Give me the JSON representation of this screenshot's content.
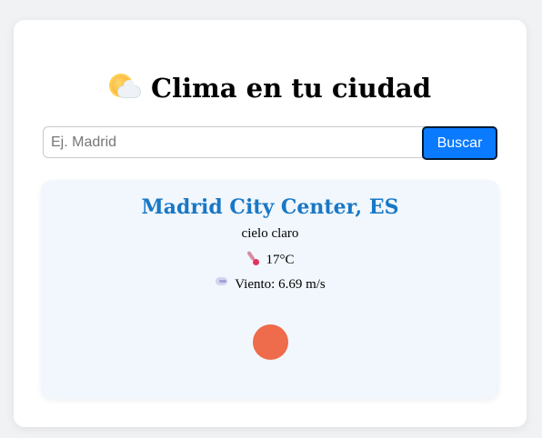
{
  "header": {
    "title": "Clima en tu ciudad",
    "title_icon": "sun-behind-cloud-icon"
  },
  "search": {
    "placeholder": "Ej. Madrid",
    "value": "",
    "button_label": "Buscar"
  },
  "weather": {
    "city": "Madrid City Center, ES",
    "description": "cielo claro",
    "temperature": "17°C",
    "temperature_icon": "thermometer-icon",
    "wind": "Viento: 6.69 m/s",
    "wind_icon": "wind-icon",
    "indicator_color": "#ee6b4b"
  },
  "colors": {
    "accent": "#0a7aff",
    "city_text": "#1978c5",
    "panel_bg": "#f1f7fd"
  }
}
